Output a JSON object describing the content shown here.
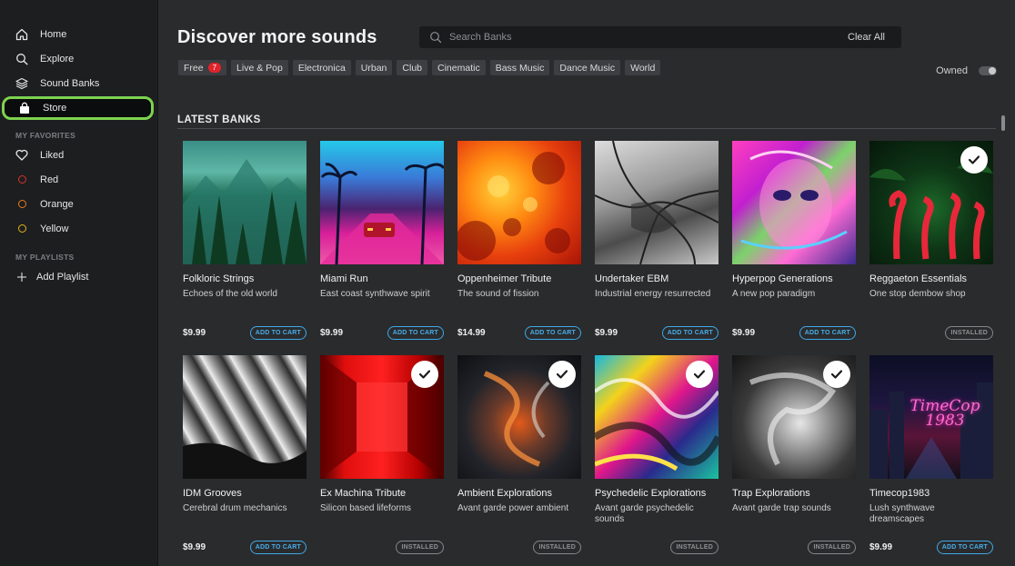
{
  "sidebar": {
    "nav": [
      {
        "label": "Home",
        "icon": "home-icon"
      },
      {
        "label": "Explore",
        "icon": "search-icon"
      },
      {
        "label": "Sound Banks",
        "icon": "layers-icon"
      },
      {
        "label": "Store",
        "icon": "shopping-bag-icon"
      }
    ],
    "favorites_label": "MY FAVORITES",
    "favorites": [
      {
        "label": "Liked",
        "icon": "heart-icon"
      },
      {
        "label": "Red",
        "color": "#d9342b"
      },
      {
        "label": "Orange",
        "color": "#e87a1a"
      },
      {
        "label": "Yellow",
        "color": "#e0b41c"
      }
    ],
    "playlists_label": "MY PLAYLISTS",
    "add_playlist": "Add Playlist"
  },
  "header": {
    "title": "Discover more sounds",
    "search_placeholder": "Search Banks",
    "clear_all": "Clear All"
  },
  "filters": [
    {
      "label": "Free",
      "count": "7"
    },
    {
      "label": "Live & Pop"
    },
    {
      "label": "Electronica"
    },
    {
      "label": "Urban"
    },
    {
      "label": "Club"
    },
    {
      "label": "Cinematic"
    },
    {
      "label": "Bass Music"
    },
    {
      "label": "Dance Music"
    },
    {
      "label": "World"
    }
  ],
  "owned_label": "Owned",
  "section_title": "LATEST BANKS",
  "banks": [
    {
      "name": "Folkloric Strings",
      "desc": "Echoes of the old world",
      "price": "$9.99",
      "action": "ADD TO CART",
      "installed": false
    },
    {
      "name": "Miami Run",
      "desc": "East coast synthwave spirit",
      "price": "$9.99",
      "action": "ADD TO CART",
      "installed": false
    },
    {
      "name": "Oppenheimer Tribute",
      "desc": "The sound of fission",
      "price": "$14.99",
      "action": "ADD TO CART",
      "installed": false
    },
    {
      "name": "Undertaker EBM",
      "desc": "Industrial energy resurrected",
      "price": "$9.99",
      "action": "ADD TO CART",
      "installed": false
    },
    {
      "name": "Hyperpop Generations",
      "desc": "A new pop paradigm",
      "price": "$9.99",
      "action": "ADD TO CART",
      "installed": false
    },
    {
      "name": "Reggaeton Essentials",
      "desc": "One stop dembow shop",
      "price": "",
      "action": "INSTALLED",
      "installed": true
    },
    {
      "name": "IDM Grooves",
      "desc": "Cerebral drum mechanics",
      "price": "$9.99",
      "action": "ADD TO CART",
      "installed": false
    },
    {
      "name": "Ex Machina Tribute",
      "desc": "Silicon based lifeforms",
      "price": "",
      "action": "INSTALLED",
      "installed": true
    },
    {
      "name": "Ambient Explorations",
      "desc": "Avant garde power ambient",
      "price": "",
      "action": "INSTALLED",
      "installed": true
    },
    {
      "name": "Psychedelic Explorations",
      "desc": "Avant garde psychedelic sounds",
      "price": "",
      "action": "INSTALLED",
      "installed": true
    },
    {
      "name": "Trap Explorations",
      "desc": "Avant garde trap sounds",
      "price": "",
      "action": "INSTALLED",
      "installed": true
    },
    {
      "name": "Timecop1983",
      "desc": "Lush synthwave dreamscapes",
      "price": "$9.99",
      "action": "ADD TO CART",
      "installed": false,
      "art_text": "TimeCop 1983"
    }
  ],
  "colors": {
    "accent_active": "#7dd34f",
    "cart_blue": "#3fa8e6",
    "badge_red": "#e0232a"
  }
}
